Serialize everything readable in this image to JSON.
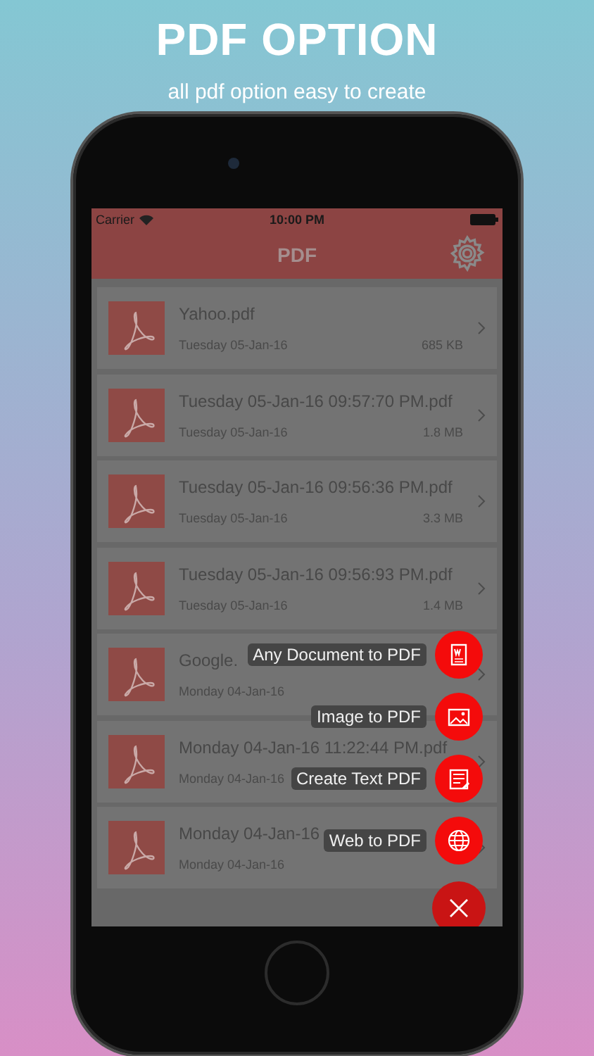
{
  "headline": "PDF OPTION",
  "subtitle": "all pdf option easy to create",
  "status_bar": {
    "carrier": "Carrier",
    "time": "10:00 PM"
  },
  "nav": {
    "title": "PDF"
  },
  "files": [
    {
      "name": "Yahoo.pdf",
      "date": "Tuesday 05-Jan-16",
      "size": "685 KB"
    },
    {
      "name": "Tuesday 05-Jan-16 09:57:70 PM.pdf",
      "date": "Tuesday 05-Jan-16",
      "size": "1.8 MB"
    },
    {
      "name": "Tuesday 05-Jan-16 09:56:36 PM.pdf",
      "date": "Tuesday 05-Jan-16",
      "size": "3.3 MB"
    },
    {
      "name": "Tuesday 05-Jan-16 09:56:93 PM.pdf",
      "date": "Tuesday 05-Jan-16",
      "size": "1.4 MB"
    },
    {
      "name": "Google.",
      "date": "Monday 04-Jan-16"
    },
    {
      "name": "Monday 04-Jan-16 11:22:44 PM.pdf",
      "date": "Monday 04-Jan-16"
    },
    {
      "name": "Monday 04-Jan-16",
      "date": "Monday 04-Jan-16"
    }
  ],
  "fab_menu": {
    "actions": [
      {
        "label": "Any Document to PDF",
        "kind": "document"
      },
      {
        "label": "Image to PDF",
        "kind": "image"
      },
      {
        "label": "Create Text PDF",
        "kind": "text"
      },
      {
        "label": "Web to PDF",
        "kind": "web"
      }
    ]
  }
}
